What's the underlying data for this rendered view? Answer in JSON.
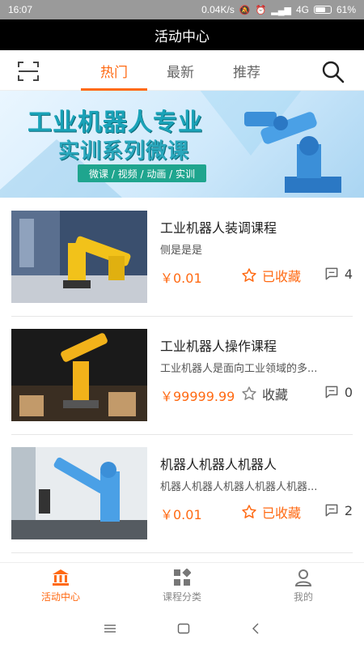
{
  "status_bar": {
    "time": "16:07",
    "network_speed": "0.04K/s",
    "signal": "4G",
    "battery": "61%"
  },
  "title_bar": {
    "title": "活动中心"
  },
  "tabs": [
    {
      "label": "热门",
      "active": true
    },
    {
      "label": "最新",
      "active": false
    },
    {
      "label": "推荐",
      "active": false
    }
  ],
  "banner": {
    "title": "工业机器人专业",
    "subtitle": "实训系列微课",
    "tags": "微课 / 视频 / 动画 / 实训"
  },
  "courses": [
    {
      "title": "工业机器人装调课程",
      "description": "侧是是是",
      "price": "￥0.01",
      "favorite_label": "已收藏",
      "favorited": true,
      "comments": "4"
    },
    {
      "title": "工业机器人操作课程",
      "description": "工业机器人是面向工业领域的多...",
      "price": "￥99999.99",
      "favorite_label": "收藏",
      "favorited": false,
      "comments": "0"
    },
    {
      "title": "机器人机器人机器人",
      "description": "机器人机器人机器人机器人机器...",
      "price": "￥0.01",
      "favorite_label": "已收藏",
      "favorited": true,
      "comments": "2"
    }
  ],
  "bottom_nav": [
    {
      "label": "活动中心",
      "icon": "building-icon",
      "active": true
    },
    {
      "label": "课程分类",
      "icon": "category-icon",
      "active": false
    },
    {
      "label": "我的",
      "icon": "user-icon",
      "active": false
    }
  ],
  "colors": {
    "accent": "#ff6a13",
    "title_bar": "#000000",
    "status_bar": "#9a9a9a"
  }
}
